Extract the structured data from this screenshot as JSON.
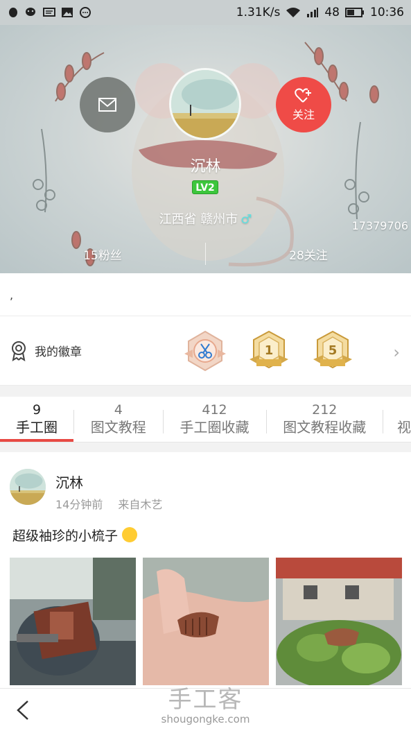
{
  "status_bar": {
    "net_speed": "1.31K/s",
    "signal_text": "48",
    "time": "10:36"
  },
  "profile": {
    "username": "沉林",
    "level": "LV2",
    "location": "江西省 赣州市",
    "gender_symbol": "♂",
    "user_id": "17379706",
    "fans_label": "15粉丝",
    "following_label": "28关注",
    "follow_label": "关注",
    "bio": ","
  },
  "badges": {
    "title": "我的徽章",
    "items": [
      {
        "icon": "scissors-badge-icon",
        "number": ""
      },
      {
        "icon": "gold-badge-icon",
        "number": "1"
      },
      {
        "icon": "gold-badge-icon",
        "number": "5"
      }
    ]
  },
  "tabs": [
    {
      "count": "9",
      "label": "手工圈",
      "active": true
    },
    {
      "count": "4",
      "label": "图文教程"
    },
    {
      "count": "412",
      "label": "手工圈收藏"
    },
    {
      "count": "212",
      "label": "图文教程收藏"
    },
    {
      "count": "",
      "label": "视"
    }
  ],
  "post": {
    "author": "沉林",
    "time": "14分钟前",
    "source": "来自木艺",
    "text": "超级袖珍的小梳子"
  },
  "watermark": {
    "title": "手工客",
    "url": "shougongke.com"
  },
  "colors": {
    "accent": "#e84a44",
    "follow_button": "#ef4b47",
    "level_badge": "#3cc63c"
  }
}
